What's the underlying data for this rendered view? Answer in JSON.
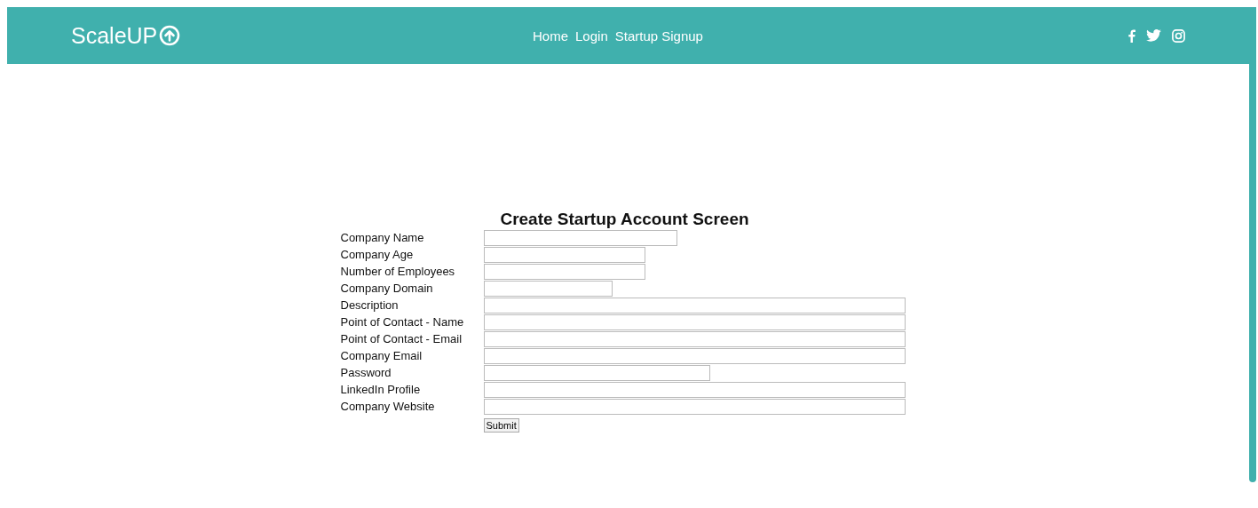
{
  "navbar": {
    "logo": "ScaleUP",
    "links": [
      {
        "label": "Home"
      },
      {
        "label": "Login"
      },
      {
        "label": "Startup Signup"
      }
    ]
  },
  "form": {
    "title": "Create Startup Account Screen",
    "fields": [
      {
        "label": "Company Name"
      },
      {
        "label": "Company Age"
      },
      {
        "label": "Number of Employees"
      },
      {
        "label": "Company Domain"
      },
      {
        "label": "Description"
      },
      {
        "label": "Point of Contact - Name"
      },
      {
        "label": "Point of Contact - Email"
      },
      {
        "label": "Company Email"
      },
      {
        "label": "Password"
      },
      {
        "label": "LinkedIn Profile"
      },
      {
        "label": "Company Website"
      }
    ],
    "submit": "Submit"
  }
}
